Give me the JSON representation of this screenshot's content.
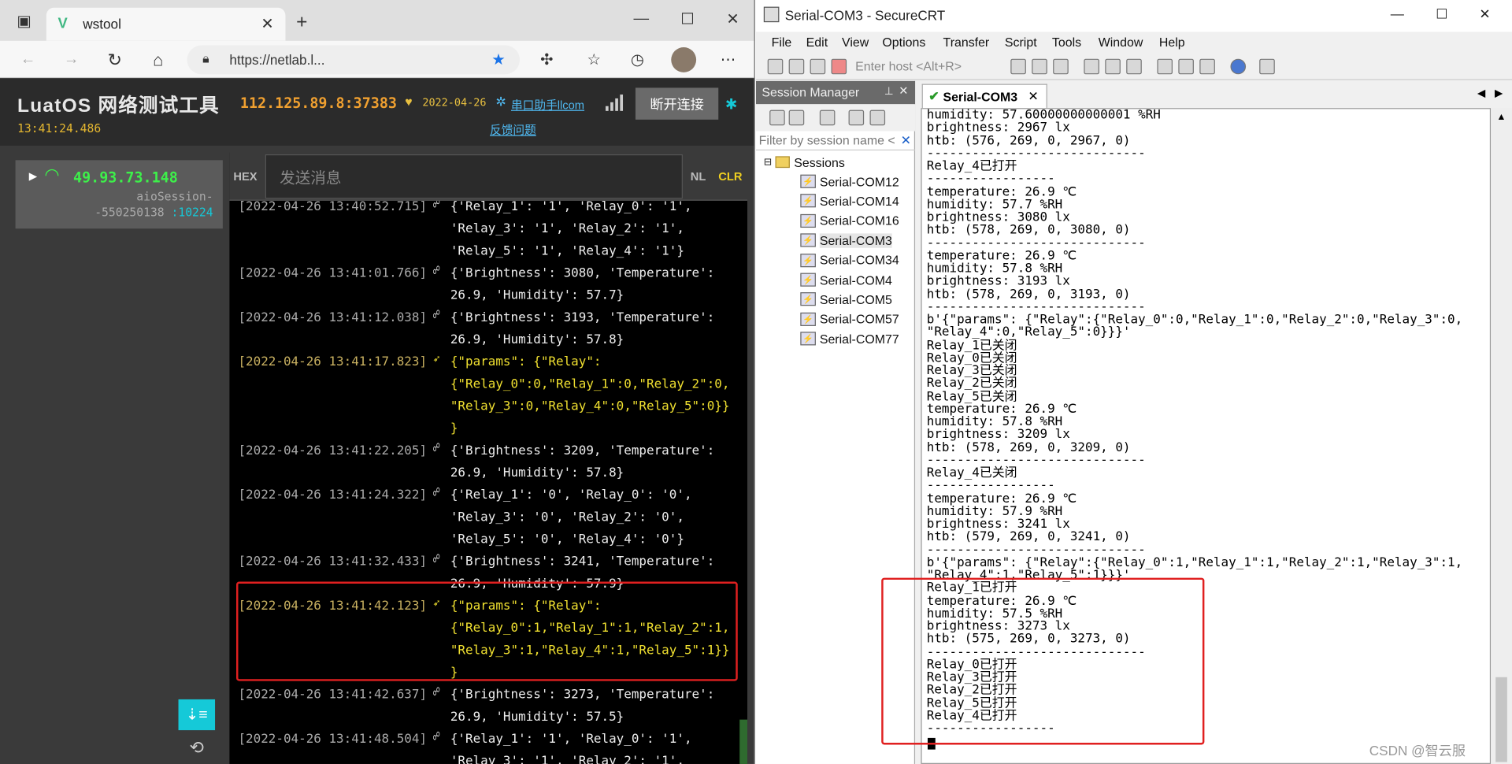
{
  "browser": {
    "tab_title": "wstool",
    "url": "https://netlab.l...",
    "app": {
      "title": "LuatOS 网络测试工具",
      "time": "13:41:24.486",
      "server": "112.125.89.8:37383",
      "date": "2022-04-26",
      "helper_link": "串口助手llcom",
      "feedback_link": "反馈问题",
      "disconnect_label": "断开连接"
    },
    "session": {
      "ip": "49.93.73.148",
      "name_line1": "aioSession-",
      "name_line2": "-550250138",
      "port": ":10224"
    },
    "sendbar": {
      "hex": "HEX",
      "placeholder": "发送消息",
      "nl": "NL",
      "clr": "CLR"
    },
    "log": [
      {
        "ts": "[2022-04-26 13:40:52.715]",
        "body": "{'Relay_1': '1', 'Relay_0': '1',\n'Relay_3': '1', 'Relay_2': '1',\n'Relay_5': '1', 'Relay_4': '1'}",
        "sent": false
      },
      {
        "ts": "[2022-04-26 13:41:01.766]",
        "body": "{'Brightness': 3080, 'Temperature':\n26.9, 'Humidity': 57.7}",
        "sent": false
      },
      {
        "ts": "[2022-04-26 13:41:12.038]",
        "body": "{'Brightness': 3193, 'Temperature':\n26.9, 'Humidity': 57.8}",
        "sent": false
      },
      {
        "ts": "[2022-04-26 13:41:17.823]",
        "body": "{\"params\": {\"Relay\":\n{\"Relay_0\":0,\"Relay_1\":0,\"Relay_2\":0,\n\"Relay_3\":0,\"Relay_4\":0,\"Relay_5\":0}}\n}",
        "sent": true
      },
      {
        "ts": "[2022-04-26 13:41:22.205]",
        "body": "{'Brightness': 3209, 'Temperature':\n26.9, 'Humidity': 57.8}",
        "sent": false
      },
      {
        "ts": "[2022-04-26 13:41:24.322]",
        "body": "{'Relay_1': '0', 'Relay_0': '0',\n'Relay_3': '0', 'Relay_2': '0',\n'Relay_5': '0', 'Relay_4': '0'}",
        "sent": false
      },
      {
        "ts": "[2022-04-26 13:41:32.433]",
        "body": "{'Brightness': 3241, 'Temperature':\n26.9, 'Humidity': 57.9}",
        "sent": false
      },
      {
        "ts": "[2022-04-26 13:41:42.123]",
        "body": "{\"params\": {\"Relay\":\n{\"Relay_0\":1,\"Relay_1\":1,\"Relay_2\":1,\n\"Relay_3\":1,\"Relay_4\":1,\"Relay_5\":1}}\n}",
        "sent": true
      },
      {
        "ts": "[2022-04-26 13:41:42.637]",
        "body": "{'Brightness': 3273, 'Temperature':\n26.9, 'Humidity': 57.5}",
        "sent": false
      },
      {
        "ts": "[2022-04-26 13:41:48.504]",
        "body": "{'Relay_1': '1', 'Relay_0': '1',\n'Relay_3': '1', 'Relay_2': '1',",
        "sent": false
      }
    ]
  },
  "crt": {
    "title": "Serial-COM3 - SecureCRT",
    "menu": [
      "File",
      "Edit",
      "View",
      "Options",
      "Transfer",
      "Script",
      "Tools",
      "Window",
      "Help"
    ],
    "host_placeholder": "Enter host <Alt+R>",
    "session_manager": "Session Manager",
    "filter_placeholder": "Filter by session name <",
    "sessions_root": "Sessions",
    "sessions": [
      "Serial-COM12",
      "Serial-COM14",
      "Serial-COM16",
      "Serial-COM3",
      "Serial-COM34",
      "Serial-COM4",
      "Serial-COM5",
      "Serial-COM57",
      "Serial-COM77"
    ],
    "active_tab": "Serial-COM3",
    "terminal": "humidity: 57.60000000000001 %RH\nbrightness: 2967 lx\nhtb: (576, 269, 0, 2967, 0)\n-----------------------------\nRelay_4已打开\n-----------------\ntemperature: 26.9 ℃\nhumidity: 57.7 %RH\nbrightness: 3080 lx\nhtb: (578, 269, 0, 3080, 0)\n-----------------------------\ntemperature: 26.9 ℃\nhumidity: 57.8 %RH\nbrightness: 3193 lx\nhtb: (578, 269, 0, 3193, 0)\n-----------------------------\nb'{\"params\": {\"Relay\":{\"Relay_0\":0,\"Relay_1\":0,\"Relay_2\":0,\"Relay_3\":0,\n\"Relay_4\":0,\"Relay_5\":0}}}'\nRelay_1已关闭\nRelay_0已关闭\nRelay_3已关闭\nRelay_2已关闭\nRelay_5已关闭\ntemperature: 26.9 ℃\nhumidity: 57.8 %RH\nbrightness: 3209 lx\nhtb: (578, 269, 0, 3209, 0)\n-----------------------------\nRelay_4已关闭\n-----------------\ntemperature: 26.9 ℃\nhumidity: 57.9 %RH\nbrightness: 3241 lx\nhtb: (579, 269, 0, 3241, 0)\n-----------------------------\nb'{\"params\": {\"Relay\":{\"Relay_0\":1,\"Relay_1\":1,\"Relay_2\":1,\"Relay_3\":1,\n\"Relay_4\":1,\"Relay_5\":1}}}'\nRelay_1已打开\ntemperature: 26.9 ℃\nhumidity: 57.5 %RH\nbrightness: 3273 lx\nhtb: (575, 269, 0, 3273, 0)\n-----------------------------\nRelay_0已打开\nRelay_3已打开\nRelay_2已打开\nRelay_5已打开\nRelay_4已打开\n-----------------",
    "watermark": "CSDN @智云服"
  },
  "colors": {
    "highlight_box": "#e02020",
    "sent_text": "#f0e030",
    "connected_ip": "#3df04a"
  }
}
